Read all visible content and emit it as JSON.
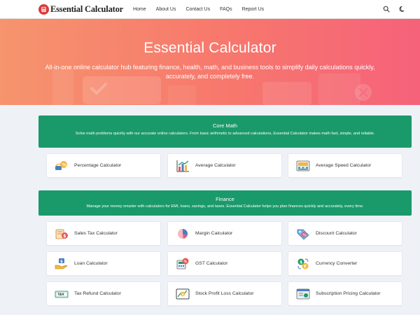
{
  "header": {
    "logo_text": "Essential Calculator",
    "nav": [
      "Home",
      "About Us",
      "Contact Us",
      "FAQs",
      "Report Us"
    ]
  },
  "hero": {
    "title": "Essential Calculator",
    "subtitle": "All-in-one online calculator hub featuring finance, health, math, and business tools to simplify daily calculations quickly, accurately, and completely free."
  },
  "core_math": {
    "title": "Core Math",
    "description": "Solve math problems quickly with our accurate online calculators. From basic arithmetic to advanced calculations, Essential Calculator makes math fast, simple, and reliable.",
    "cards": [
      {
        "label": "Percentage Calculator",
        "icon": "percentage-icon"
      },
      {
        "label": "Average Calculator",
        "icon": "bar-chart-icon"
      },
      {
        "label": "Average Speed Calculator",
        "icon": "speedometer-icon"
      }
    ]
  },
  "finance": {
    "title": "Finance",
    "description": "Manage your money smarter with calculators for EMI, loans, savings, and taxes. Essential Calculator helps you plan finances quickly and accurately, every time.",
    "cards": [
      {
        "label": "Sales Tax Calculator",
        "icon": "sales-tax-icon"
      },
      {
        "label": "Margin Calculator",
        "icon": "pie-chart-icon"
      },
      {
        "label": "Discount Calculator",
        "icon": "discount-tag-icon"
      },
      {
        "label": "Loan Calculator",
        "icon": "loan-hand-icon"
      },
      {
        "label": "GST Calculator",
        "icon": "gst-icon"
      },
      {
        "label": "Currency Converter",
        "icon": "currency-exchange-icon"
      },
      {
        "label": "Tax Refund Calculator",
        "icon": "tax-refund-icon"
      },
      {
        "label": "Stock Profit Loss Calculator",
        "icon": "stock-chart-icon"
      },
      {
        "label": "Subscription Pricing Calculator",
        "icon": "subscription-icon"
      }
    ]
  },
  "colors": {
    "section_green": "#1a9a6a",
    "hero_start": "#f6946d",
    "hero_end": "#f5627a",
    "logo_red": "#d93a3a"
  }
}
